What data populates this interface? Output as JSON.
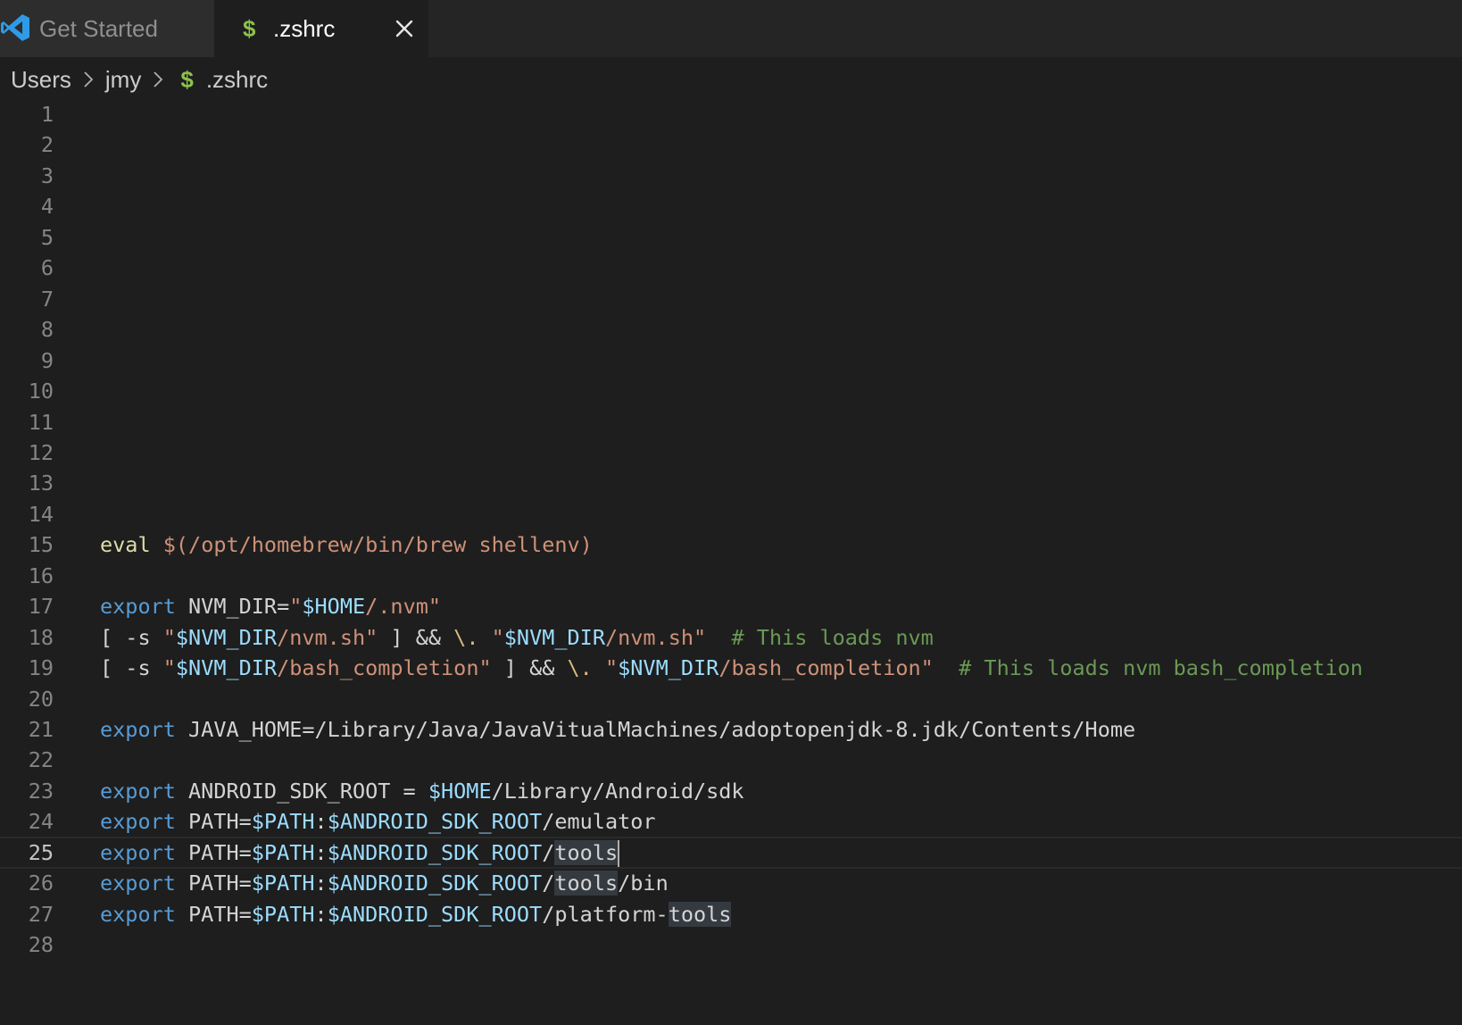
{
  "tabs": [
    {
      "label": "Get Started",
      "icon": "vscode-logo-icon",
      "active": false
    },
    {
      "label": ".zshrc",
      "icon": "dollar-icon",
      "active": true,
      "icon_glyph": "$",
      "close_glyph": "close-icon"
    }
  ],
  "breadcrumb": {
    "items": [
      "Users",
      "jmy",
      ".zshrc"
    ],
    "file_icon_glyph": "$"
  },
  "editor": {
    "current_line": 25,
    "lines": [
      {
        "n": "1",
        "tokens": []
      },
      {
        "n": "2",
        "tokens": []
      },
      {
        "n": "3",
        "tokens": []
      },
      {
        "n": "4",
        "tokens": []
      },
      {
        "n": "5",
        "tokens": []
      },
      {
        "n": "6",
        "tokens": []
      },
      {
        "n": "7",
        "tokens": []
      },
      {
        "n": "8",
        "tokens": []
      },
      {
        "n": "9",
        "tokens": []
      },
      {
        "n": "10",
        "tokens": []
      },
      {
        "n": "11",
        "tokens": []
      },
      {
        "n": "12",
        "tokens": []
      },
      {
        "n": "13",
        "tokens": []
      },
      {
        "n": "14",
        "tokens": []
      },
      {
        "n": "15",
        "tokens": [
          {
            "t": "eval",
            "k": "builtin"
          },
          {
            "t": " ",
            "k": "default"
          },
          {
            "t": "$(/opt/homebrew/bin/brew shellenv)",
            "k": "string"
          }
        ]
      },
      {
        "n": "16",
        "tokens": []
      },
      {
        "n": "17",
        "tokens": [
          {
            "t": "export",
            "k": "keyword"
          },
          {
            "t": " NVM_DIR=",
            "k": "default"
          },
          {
            "t": "\"",
            "k": "string"
          },
          {
            "t": "$HOME",
            "k": "var"
          },
          {
            "t": "/.nvm\"",
            "k": "string"
          }
        ]
      },
      {
        "n": "18",
        "tokens": [
          {
            "t": "[ -s ",
            "k": "default"
          },
          {
            "t": "\"",
            "k": "string"
          },
          {
            "t": "$NVM_DIR",
            "k": "var"
          },
          {
            "t": "/nvm.sh\"",
            "k": "string"
          },
          {
            "t": " ] && ",
            "k": "default"
          },
          {
            "t": "\\.",
            "k": "esc"
          },
          {
            "t": " ",
            "k": "default"
          },
          {
            "t": "\"",
            "k": "string"
          },
          {
            "t": "$NVM_DIR",
            "k": "var"
          },
          {
            "t": "/nvm.sh\"",
            "k": "string"
          },
          {
            "t": "  ",
            "k": "default"
          },
          {
            "t": "# This loads nvm",
            "k": "comment"
          }
        ]
      },
      {
        "n": "19",
        "tokens": [
          {
            "t": "[ -s ",
            "k": "default"
          },
          {
            "t": "\"",
            "k": "string"
          },
          {
            "t": "$NVM_DIR",
            "k": "var"
          },
          {
            "t": "/bash_completion\"",
            "k": "string"
          },
          {
            "t": " ] && ",
            "k": "default"
          },
          {
            "t": "\\.",
            "k": "esc"
          },
          {
            "t": " ",
            "k": "default"
          },
          {
            "t": "\"",
            "k": "string"
          },
          {
            "t": "$NVM_DIR",
            "k": "var"
          },
          {
            "t": "/bash_completion\"",
            "k": "string"
          },
          {
            "t": "  ",
            "k": "default"
          },
          {
            "t": "# This loads nvm bash_completion",
            "k": "comment"
          }
        ]
      },
      {
        "n": "20",
        "tokens": []
      },
      {
        "n": "21",
        "tokens": [
          {
            "t": "export",
            "k": "keyword"
          },
          {
            "t": " JAVA_HOME=/Library/Java/JavaVitualMachines/adoptopenjdk-8.jdk/Contents/Home",
            "k": "default"
          }
        ]
      },
      {
        "n": "22",
        "tokens": []
      },
      {
        "n": "23",
        "tokens": [
          {
            "t": "export",
            "k": "keyword"
          },
          {
            "t": " ANDROID_SDK_ROOT = ",
            "k": "default"
          },
          {
            "t": "$HOME",
            "k": "var"
          },
          {
            "t": "/Library/Android/sdk",
            "k": "default"
          }
        ]
      },
      {
        "n": "24",
        "tokens": [
          {
            "t": "export",
            "k": "keyword"
          },
          {
            "t": " PATH=",
            "k": "default"
          },
          {
            "t": "$PATH",
            "k": "var"
          },
          {
            "t": ":",
            "k": "default"
          },
          {
            "t": "$ANDROID_SDK_ROOT",
            "k": "var"
          },
          {
            "t": "/emulator",
            "k": "default"
          }
        ]
      },
      {
        "n": "25",
        "tokens": [
          {
            "t": "export",
            "k": "keyword"
          },
          {
            "t": " PATH=",
            "k": "default"
          },
          {
            "t": "$PATH",
            "k": "var"
          },
          {
            "t": ":",
            "k": "default"
          },
          {
            "t": "$ANDROID_SDK_ROOT",
            "k": "var"
          },
          {
            "t": "/",
            "k": "default"
          },
          {
            "t": "tools",
            "k": "default",
            "hl": true
          },
          {
            "t": "",
            "k": "cursor"
          }
        ]
      },
      {
        "n": "26",
        "tokens": [
          {
            "t": "export",
            "k": "keyword"
          },
          {
            "t": " PATH=",
            "k": "default"
          },
          {
            "t": "$PATH",
            "k": "var"
          },
          {
            "t": ":",
            "k": "default"
          },
          {
            "t": "$ANDROID_SDK_ROOT",
            "k": "var"
          },
          {
            "t": "/",
            "k": "default"
          },
          {
            "t": "tools",
            "k": "default",
            "hl": true
          },
          {
            "t": "/bin",
            "k": "default"
          }
        ]
      },
      {
        "n": "27",
        "tokens": [
          {
            "t": "export",
            "k": "keyword"
          },
          {
            "t": " PATH=",
            "k": "default"
          },
          {
            "t": "$PATH",
            "k": "var"
          },
          {
            "t": ":",
            "k": "default"
          },
          {
            "t": "$ANDROID_SDK_ROOT",
            "k": "var"
          },
          {
            "t": "/platform-",
            "k": "default"
          },
          {
            "t": "tools",
            "k": "default",
            "hl": true
          }
        ]
      },
      {
        "n": "28",
        "tokens": []
      }
    ]
  }
}
